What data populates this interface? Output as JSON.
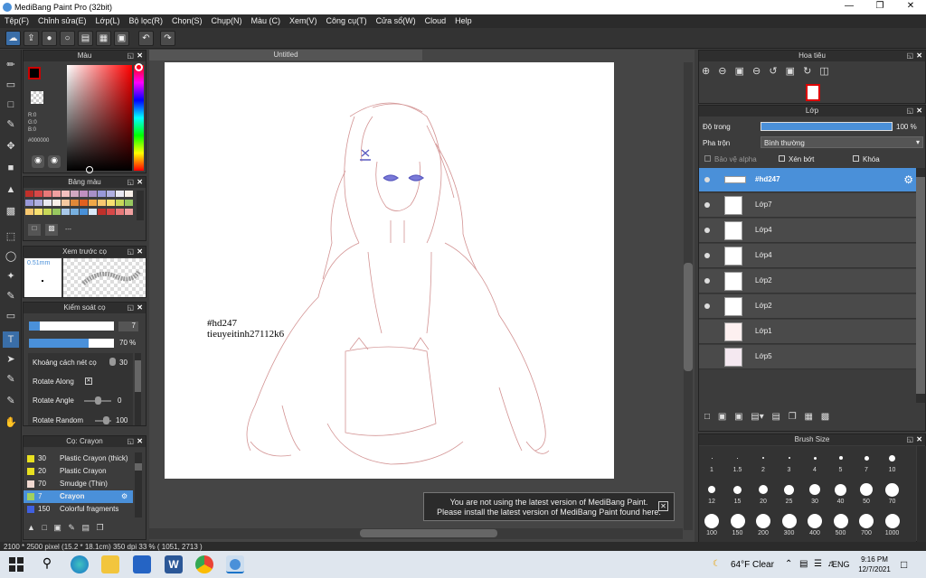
{
  "window": {
    "title": "MediBang Paint Pro (32bit)"
  },
  "menu": [
    "Tệp(F)",
    "Chỉnh sửa(E)",
    "Lớp(L)",
    "Bộ lọc(R)",
    "Chọn(S)",
    "Chụp(N)",
    "Màu (C)",
    "Xem(V)",
    "Công cụ(T)",
    "Cửa sổ(W)",
    "Cloud",
    "Help"
  ],
  "color_panel": {
    "title": "Màu",
    "r": "R:0",
    "g": "G:0",
    "b": "B:0",
    "hex": "#000000"
  },
  "palette_panel": {
    "title": "Bảng màu",
    "entry": "---"
  },
  "brush_preview": {
    "title": "Xem trước cọ",
    "size": "0.51mm"
  },
  "brush_control": {
    "title": "Kiểm soát cọ",
    "size_value": "7",
    "opacity_value": "70 %",
    "opacity": 0.7,
    "rows": [
      {
        "label": "Khoảng cách nét cọ",
        "value": "30"
      },
      {
        "label": "Rotate Along",
        "value": ""
      },
      {
        "label": "Rotate Angle",
        "value": "0"
      },
      {
        "label": "Rotate Random",
        "value": "100"
      }
    ]
  },
  "brush_list": {
    "title": "Cọ: Crayon",
    "items": [
      {
        "num": "30",
        "name": "Plastic Crayon (thick)",
        "color": "#e8e020"
      },
      {
        "num": "20",
        "name": "Plastic Crayon",
        "color": "#e8e020"
      },
      {
        "num": "70",
        "name": "Smudge (Thin)",
        "color": "#f0d8d0"
      },
      {
        "num": "7",
        "name": "Crayon",
        "color": "#a0d060",
        "selected": true
      },
      {
        "num": "150",
        "name": "Colorful fragments",
        "color": "#4060e0"
      }
    ]
  },
  "canvas": {
    "tab": "Untitled",
    "signature_line1": "#hd247",
    "signature_line2": "tieuyeitinh27112k6"
  },
  "notice": {
    "line1": "You are not using the latest version of MediBang Paint.",
    "line2": "Please install the latest version of MediBang Paint found here."
  },
  "navigator": {
    "title": "Hoa tiêu"
  },
  "layer_panel": {
    "title": "Lớp",
    "opacity_label": "Độ trong",
    "opacity_value": "100 %",
    "blend_label": "Pha trộn",
    "blend_value": "Bình thường",
    "protect_alpha": "Bảo vệ alpha",
    "clipping": "Xén bớt",
    "lock": "Khóa",
    "layers": [
      {
        "name": "#hd247",
        "selected": true
      },
      {
        "name": "Lớp7"
      },
      {
        "name": "Lớp4"
      },
      {
        "name": "Lớp4"
      },
      {
        "name": "Lớp2"
      },
      {
        "name": "Lớp2"
      },
      {
        "name": "Lớp1"
      },
      {
        "name": "Lớp5"
      }
    ]
  },
  "brush_size": {
    "title": "Brush Size",
    "sizes": [
      "1",
      "1.5",
      "2",
      "3",
      "4",
      "5",
      "7",
      "10",
      "12",
      "15",
      "20",
      "25",
      "30",
      "40",
      "50",
      "70",
      "100",
      "150",
      "200",
      "300",
      "400",
      "500",
      "700",
      "1000"
    ]
  },
  "status": {
    "text": "2100 * 2500 pixel   (15.2 * 18.1cm)   350 dpi   33 %   ( 1051, 2713 )"
  },
  "taskbar": {
    "weather": "64°F  Clear",
    "lang": "ENG",
    "time": "9:16 PM",
    "date": "12/7/2021"
  }
}
